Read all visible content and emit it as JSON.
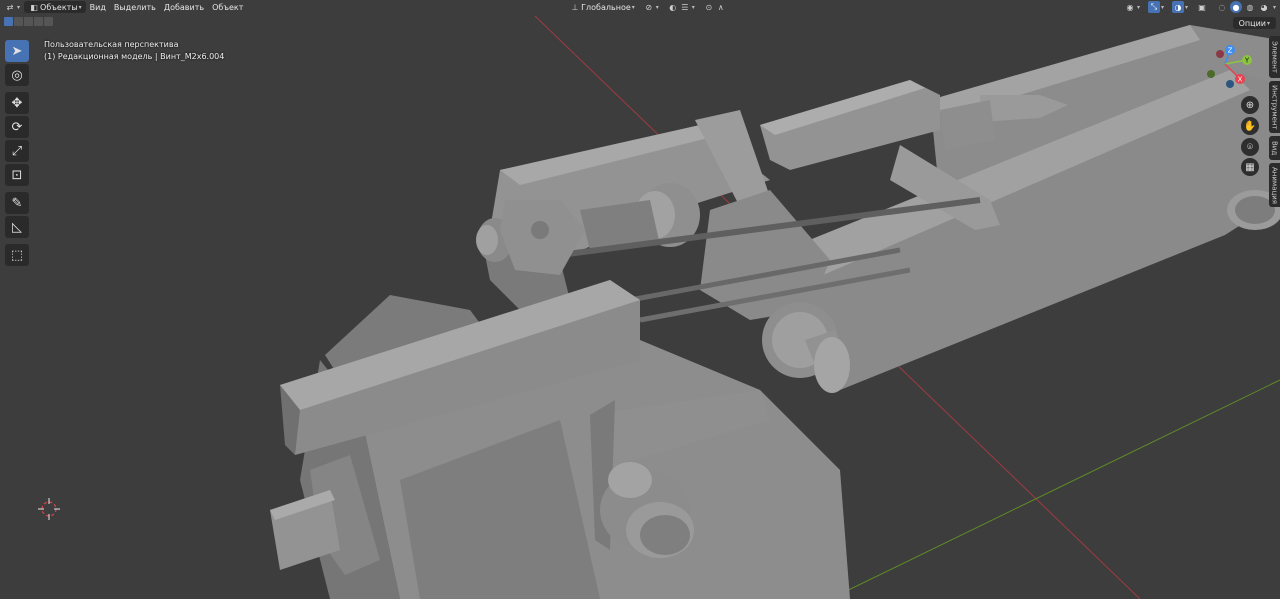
{
  "header": {
    "mode_label": "Объекты",
    "menus": [
      "Вид",
      "Выделить",
      "Добавить",
      "Объект"
    ],
    "orientation_label": "Глобальное",
    "options_label": "Опции"
  },
  "overlay": {
    "view_name": "Пользовательская перспектива",
    "object_info": "(1) Редакционная модель | Винт_M2x6.004"
  },
  "toolbar": {
    "tools": [
      "select-box-tool",
      "cursor-tool",
      "move-tool",
      "rotate-tool",
      "scale-tool",
      "transform-tool",
      "annotate-tool",
      "measure-tool",
      "add-cube-tool"
    ]
  },
  "sidebar_tabs": [
    "Элемент",
    "Инструмент",
    "Вид",
    "Анимация"
  ],
  "gizmo": {
    "x_label": "X",
    "y_label": "Y",
    "z_label": "Z",
    "colors": {
      "x": "#e8414f",
      "y": "#8bc53f",
      "z": "#3d8ef0"
    }
  },
  "colors": {
    "viewport_bg": "#3d3d3d",
    "header_bg": "#2b2b2b",
    "accent": "#4772b3",
    "model_face": "#8f8f8f",
    "model_dark": "#6c6c6c",
    "model_light": "#a6a6a6",
    "axis_x": "#b33a44",
    "axis_y": "#6a9a2a"
  }
}
